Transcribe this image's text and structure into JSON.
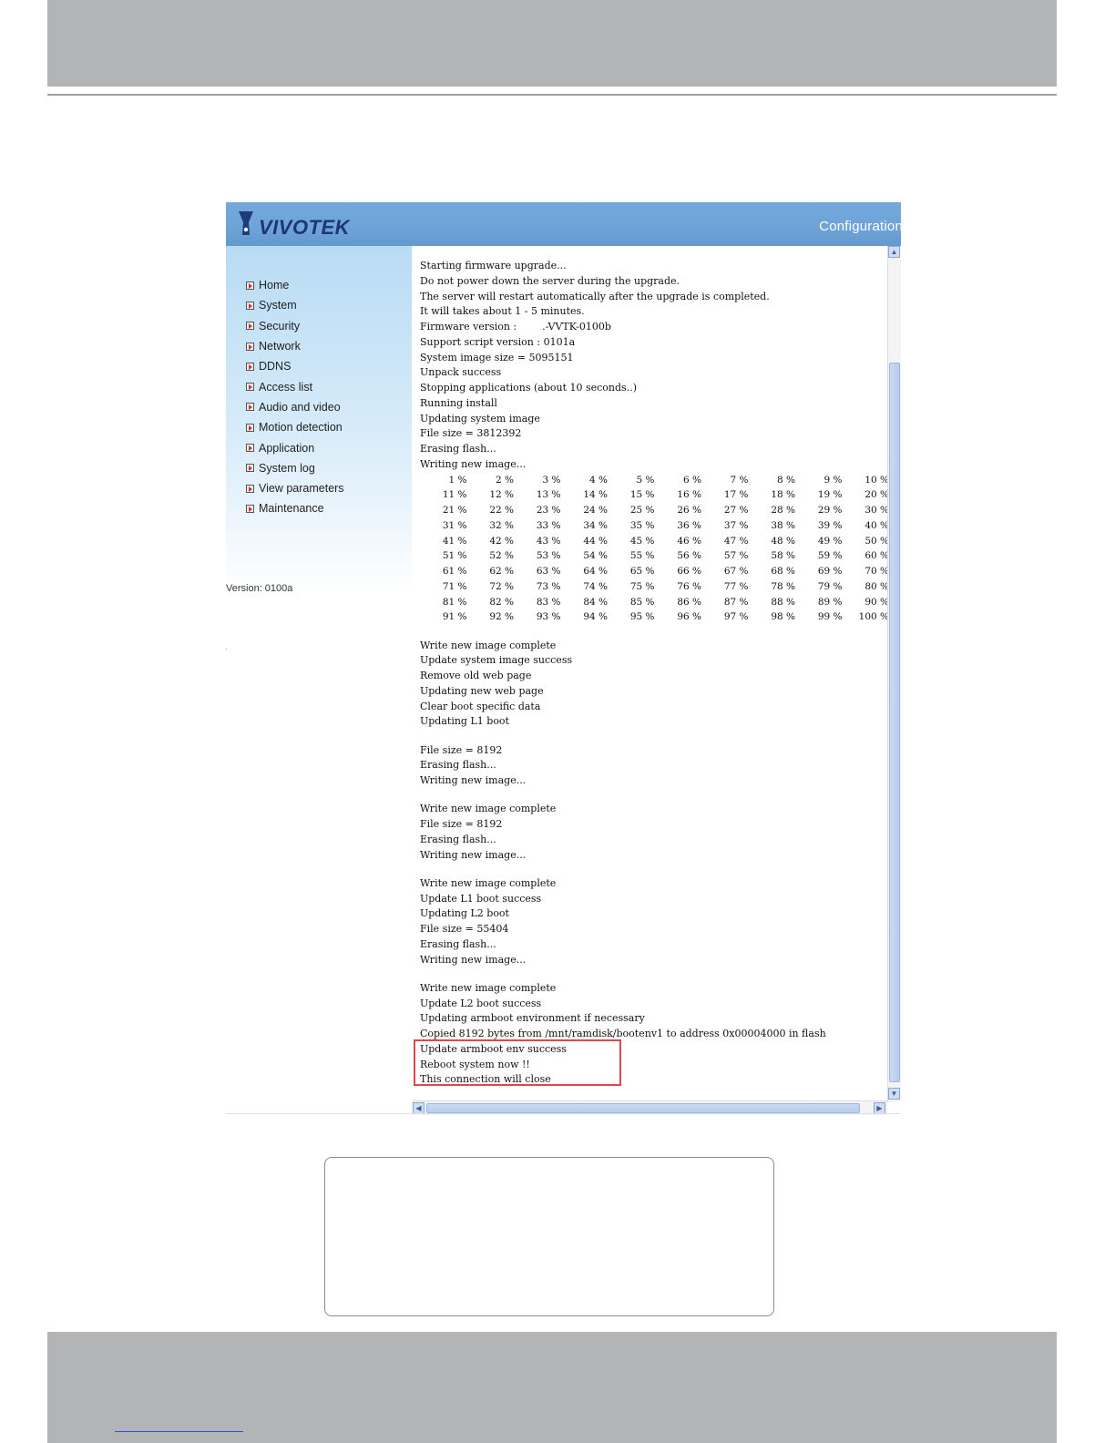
{
  "app": {
    "brand": "VIVOTEK",
    "section_title": "Configuration"
  },
  "sidebar": {
    "items": [
      {
        "label": "Home"
      },
      {
        "label": "System"
      },
      {
        "label": "Security"
      },
      {
        "label": "Network"
      },
      {
        "label": "DDNS"
      },
      {
        "label": "Access list"
      },
      {
        "label": "Audio and video"
      },
      {
        "label": "Motion detection"
      },
      {
        "label": "Application"
      },
      {
        "label": "System log"
      },
      {
        "label": "View parameters"
      },
      {
        "label": "Maintenance"
      }
    ],
    "version": "Version: 0100a"
  },
  "log": {
    "lines_a": [
      "Starting firmware upgrade...",
      "Do not power down the server during the upgrade.",
      "The server will restart automatically after the upgrade is completed.",
      "It will takes about 1 - 5 minutes.",
      "Firmware version :        .-VVTK-0100b",
      "Support script version : 0101a",
      "System image size = 5095151",
      "Unpack success",
      "Stopping applications (about 10 seconds..)",
      "Running install",
      "Updating system image",
      "File size = 3812392",
      "Erasing flash...",
      "Writing new image..."
    ],
    "progress": [
      [
        "1 %",
        "2 %",
        "3 %",
        "4 %",
        "5 %",
        "6 %",
        "7 %",
        "8 %",
        "9 %",
        "10 %"
      ],
      [
        "11 %",
        "12 %",
        "13 %",
        "14 %",
        "15 %",
        "16 %",
        "17 %",
        "18 %",
        "19 %",
        "20 %"
      ],
      [
        "21 %",
        "22 %",
        "23 %",
        "24 %",
        "25 %",
        "26 %",
        "27 %",
        "28 %",
        "29 %",
        "30 %"
      ],
      [
        "31 %",
        "32 %",
        "33 %",
        "34 %",
        "35 %",
        "36 %",
        "37 %",
        "38 %",
        "39 %",
        "40 %"
      ],
      [
        "41 %",
        "42 %",
        "43 %",
        "44 %",
        "45 %",
        "46 %",
        "47 %",
        "48 %",
        "49 %",
        "50 %"
      ],
      [
        "51 %",
        "52 %",
        "53 %",
        "54 %",
        "55 %",
        "56 %",
        "57 %",
        "58 %",
        "59 %",
        "60 %"
      ],
      [
        "61 %",
        "62 %",
        "63 %",
        "64 %",
        "65 %",
        "66 %",
        "67 %",
        "68 %",
        "69 %",
        "70 %"
      ],
      [
        "71 %",
        "72 %",
        "73 %",
        "74 %",
        "75 %",
        "76 %",
        "77 %",
        "78 %",
        "79 %",
        "80 %"
      ],
      [
        "81 %",
        "82 %",
        "83 %",
        "84 %",
        "85 %",
        "86 %",
        "87 %",
        "88 %",
        "89 %",
        "90 %"
      ],
      [
        "91 %",
        "92 %",
        "93 %",
        "94 %",
        "95 %",
        "96 %",
        "97 %",
        "98 %",
        "99 %",
        "100 %"
      ]
    ],
    "lines_b": [
      "Write new image complete",
      "Update system image success",
      "Remove old web page",
      "Updating new web page",
      "Clear boot specific data",
      "Updating L1 boot"
    ],
    "lines_c": [
      "File size = 8192",
      "Erasing flash...",
      "Writing new image..."
    ],
    "lines_d": [
      "Write new image complete",
      "File size = 8192",
      "Erasing flash...",
      "Writing new image..."
    ],
    "lines_e": [
      "Write new image complete",
      "Update L1 boot success",
      "Updating L2 boot",
      "File size = 55404",
      "Erasing flash...",
      "Writing new image..."
    ],
    "lines_f": [
      "Write new image complete",
      "Update L2 boot success",
      "Updating armboot environment if necessary",
      "Copied 8192 bytes from /mnt/ramdisk/bootenv1 to address 0x00004000 in flash",
      "Update armboot env success",
      "Reboot system now !!",
      "This connection will close"
    ]
  },
  "colors": {
    "banner": "#6ea3d8",
    "highlight_box": "#e04848",
    "page_band": "#b3b4b6"
  },
  "icons": {
    "nav_bullet": "arrow-bullet-icon",
    "scroll_up": "scroll-up-arrow-icon",
    "scroll_down": "scroll-down-arrow-icon",
    "scroll_left": "scroll-left-arrow-icon",
    "scroll_right": "scroll-right-arrow-icon"
  }
}
